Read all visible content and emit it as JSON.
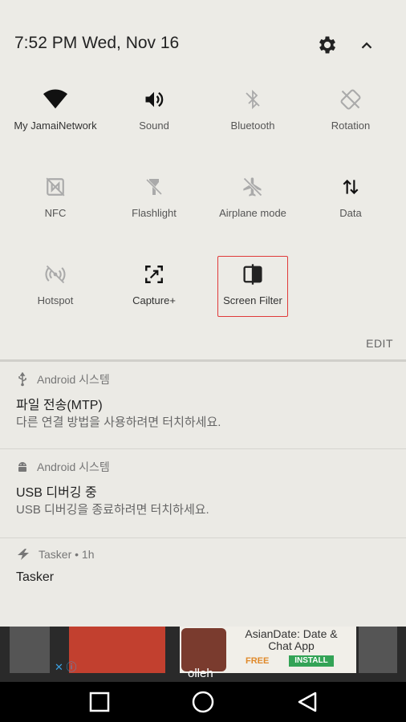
{
  "header": {
    "time": "7:52 PM",
    "date": "Wed, Nov 16"
  },
  "tiles": [
    {
      "label": "My JamaiNetwork",
      "icon": "wifi-icon"
    },
    {
      "label": "Sound",
      "icon": "volume-icon"
    },
    {
      "label": "Bluetooth",
      "icon": "bluetooth-off-icon"
    },
    {
      "label": "Rotation",
      "icon": "rotation-off-icon"
    },
    {
      "label": "NFC",
      "icon": "nfc-off-icon"
    },
    {
      "label": "Flashlight",
      "icon": "flashlight-off-icon"
    },
    {
      "label": "Airplane mode",
      "icon": "airplane-off-icon"
    },
    {
      "label": "Data",
      "icon": "data-icon"
    },
    {
      "label": "Hotspot",
      "icon": "hotspot-off-icon"
    },
    {
      "label": "Capture+",
      "icon": "capture-icon"
    },
    {
      "label": "Screen Filter",
      "icon": "screen-filter-icon"
    }
  ],
  "edit_label": "EDIT",
  "notifications": [
    {
      "app": "Android 시스템",
      "title": "파일 전송(MTP)",
      "body": "다른 연결 방법을 사용하려면 터치하세요.",
      "icon": "usb-icon"
    },
    {
      "app": "Android 시스템",
      "title": "USB 디버깅 중",
      "body": "USB 디버깅을 종료하려면 터치하세요.",
      "icon": "android-icon"
    },
    {
      "app": "Tasker • 1h",
      "title": "Tasker",
      "body": "",
      "icon": "tasker-icon"
    }
  ],
  "ad": {
    "title": "AsianDate: Date & Chat App",
    "free": "FREE",
    "install": "INSTALL",
    "carrier": "olleh"
  },
  "colors": {
    "highlight": "#e03a3a",
    "panel": "#ecebe6"
  }
}
